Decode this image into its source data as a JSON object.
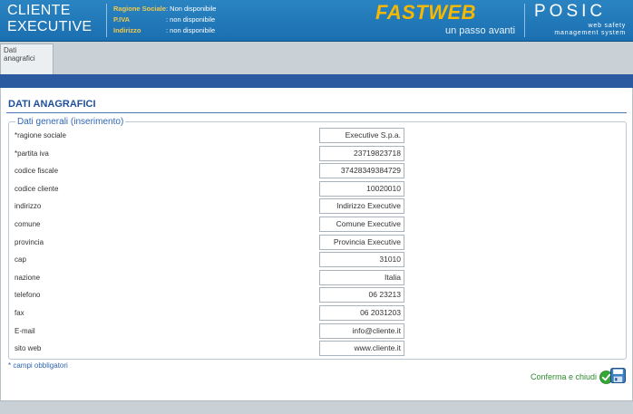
{
  "header": {
    "title_line1": "CLIENTE",
    "title_line2": "EXECUTIVE",
    "info": [
      {
        "label": "Ragione Sociale",
        "value": ": Non disponibile"
      },
      {
        "label": "P.IVA",
        "value": ": non disponibile"
      },
      {
        "label": "Indirizzo",
        "value": ": non disponibile"
      }
    ],
    "fastweb_logo": "FASTWEB",
    "fastweb_tagline": "un passo avanti",
    "posic_logo": "POSIC",
    "posic_sub1": "web safety",
    "posic_sub2": "management system"
  },
  "tabs": [
    {
      "label": "Dati anagrafici"
    }
  ],
  "main": {
    "title": "DATI ANAGRAFICI",
    "legend": "Dati generali (inserimento)",
    "fields": [
      {
        "label": "*ragione sociale",
        "value": "Executive S.p.a."
      },
      {
        "label": "*partita iva",
        "value": "23719823718"
      },
      {
        "label": "codice fiscale",
        "value": "37428349384729"
      },
      {
        "label": "codice cliente",
        "value": "10020010"
      },
      {
        "label": "indirizzo",
        "value": "Indirizzo Executive"
      },
      {
        "label": "comune",
        "value": "Comune Executive"
      },
      {
        "label": "provincia",
        "value": "Provincia Executive"
      },
      {
        "label": "cap",
        "value": "31010"
      },
      {
        "label": "nazione",
        "value": "Italia"
      },
      {
        "label": "telefono",
        "value": "06 23213"
      },
      {
        "label": "fax",
        "value": "06 2031203"
      },
      {
        "label": "E-mail",
        "value": "info@cliente.it"
      },
      {
        "label": "sito web",
        "value": "www.cliente.it"
      }
    ],
    "required_note": "* campi obbligatori",
    "confirm_label": "Conferma e chiudi"
  },
  "colors": {
    "header_blue": "#1f77b8",
    "bar_blue": "#2c5aa0",
    "fastweb_yellow": "#f6b800",
    "title_blue": "#1e4f9c",
    "confirm_green": "#2f8a2f"
  }
}
